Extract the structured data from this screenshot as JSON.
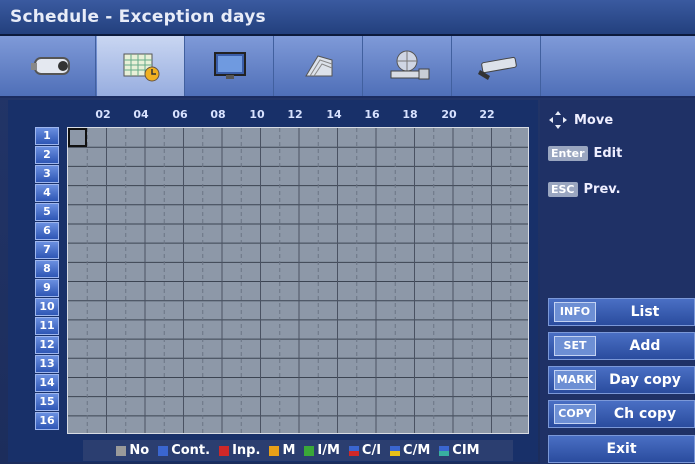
{
  "window": {
    "title": "Schedule - Exception days"
  },
  "tabs": [
    {
      "icon": "camera-icon"
    },
    {
      "icon": "schedule-calendar-icon",
      "active": true
    },
    {
      "icon": "monitor-icon"
    },
    {
      "icon": "storage-icon"
    },
    {
      "icon": "network-icon"
    },
    {
      "icon": "tools-icon"
    }
  ],
  "grid": {
    "hour_labels": [
      "02",
      "04",
      "06",
      "08",
      "10",
      "12",
      "14",
      "16",
      "18",
      "20",
      "22"
    ],
    "channels": [
      "1",
      "2",
      "3",
      "4",
      "5",
      "6",
      "7",
      "8",
      "9",
      "10",
      "11",
      "12",
      "13",
      "14",
      "15",
      "16"
    ]
  },
  "legend": [
    {
      "label": "No",
      "color": "#9a9a9a"
    },
    {
      "label": "Cont.",
      "color": "#3a66d0"
    },
    {
      "label": "Inp.",
      "color": "#d02828"
    },
    {
      "label": "M",
      "color": "#e8a018"
    },
    {
      "label": "I/M",
      "color": "#3aa838"
    },
    {
      "label": "C/I",
      "color": "#d02828"
    },
    {
      "label": "C/M",
      "color": "#e8c018"
    },
    {
      "label": "CIM",
      "color": "#38b0a0"
    }
  ],
  "hints": {
    "move": "Move",
    "enter_key": "Enter",
    "edit": "Edit",
    "esc_key": "ESC",
    "prev": "Prev."
  },
  "buttons": {
    "list": {
      "key": "INFO",
      "label": "List"
    },
    "add": {
      "key": "SET",
      "label": "Add"
    },
    "day_copy": {
      "key": "MARK",
      "label": "Day copy"
    },
    "ch_copy": {
      "key": "COPY",
      "label": "Ch copy"
    },
    "exit": {
      "label": "Exit"
    }
  }
}
